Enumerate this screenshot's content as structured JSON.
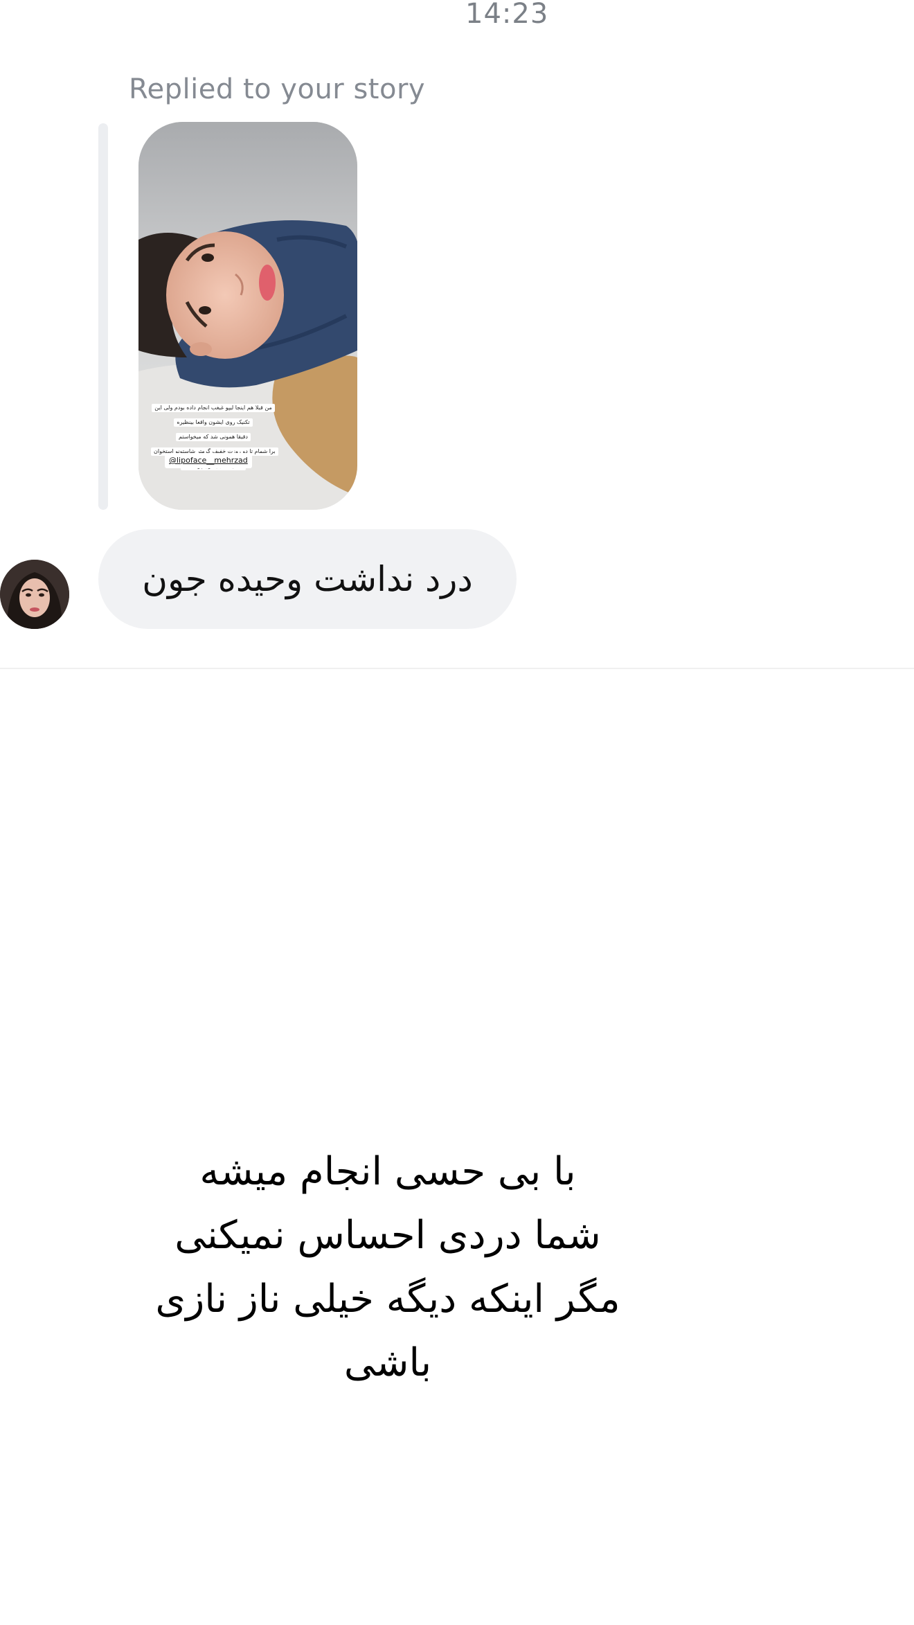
{
  "header": {
    "time": "14:23"
  },
  "message": {
    "reply_label": "Replied to your story",
    "story": {
      "caption_lines": [
        "من قبلا هم اینجا لیپو غبغب انجام داده بودم ولی این",
        "تکنیک روی ایشون واقعا بینظیره",
        "دقیقا همونی شد که میخواستم",
        "برا شمام تا دو روزت خفیف گرمتر شاستونو استخوان",
        "کتفی تا ثابتیشون پر نشده"
      ],
      "handle": "@lipoface__mehrzad"
    },
    "text": "درد نداشت وحیده جون",
    "sender_avatar": "avatar"
  },
  "overlay": {
    "lines": [
      "با بی حسی انجام میشه",
      "شما دردی احساس نمیکنی",
      "مگر اینکه دیگه خیلی ناز نازی باشی"
    ]
  },
  "colors": {
    "bubble": "#f1f2f4",
    "reply_label": "#858a92",
    "timestamp": "#7b8087",
    "scarf": "#33496e",
    "lips": "#e0606c"
  }
}
